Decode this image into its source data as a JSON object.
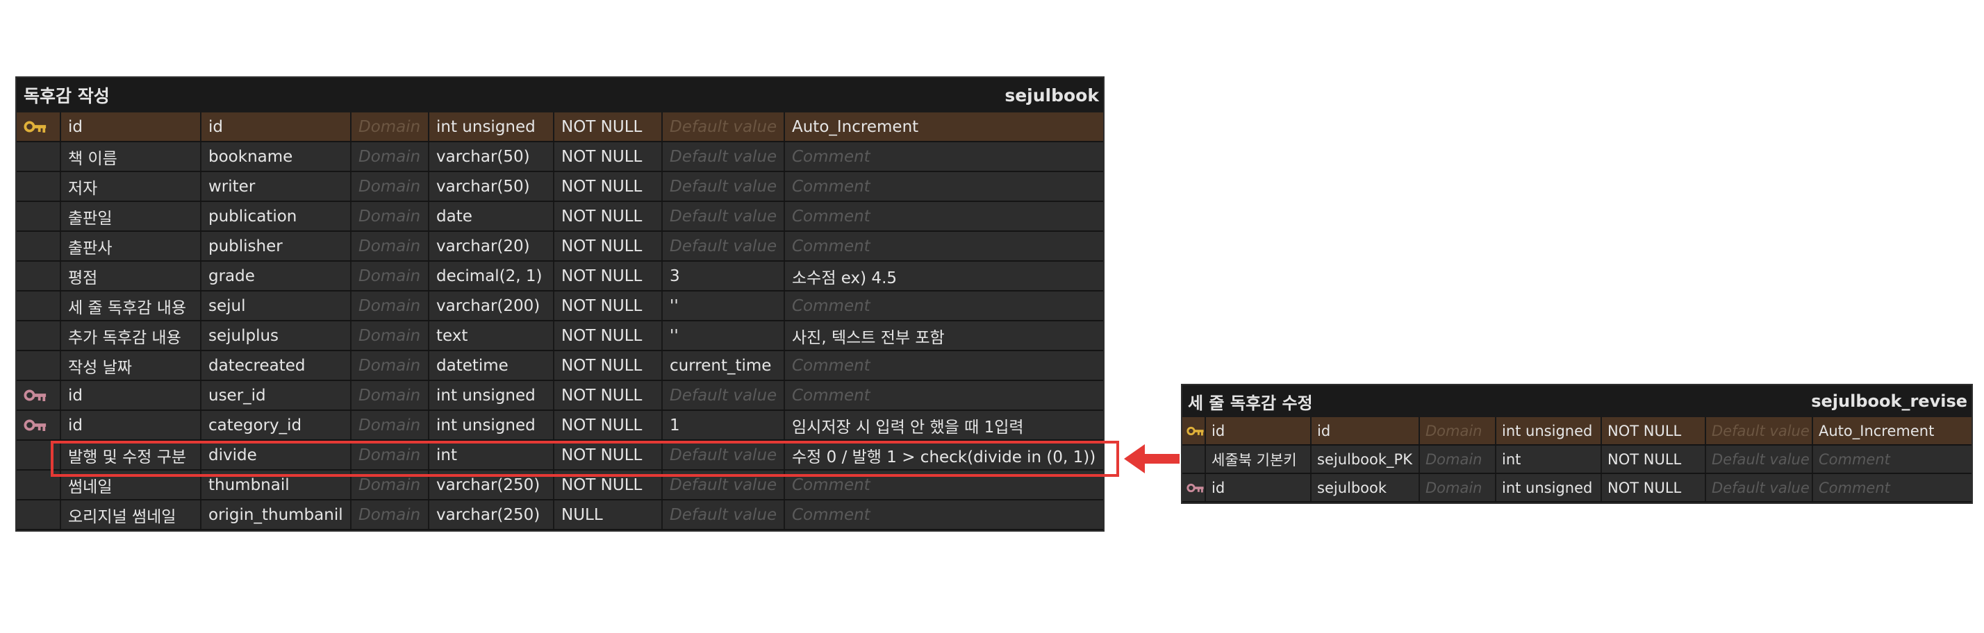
{
  "table1": {
    "title": "독후감 작성",
    "name": "sejulbook",
    "rows": [
      {
        "key": "pk",
        "logical": "id",
        "physical": "id",
        "domain": "Domain",
        "type": "int unsigned",
        "null": "NOT NULL",
        "default": "Default value",
        "comment": "Auto_Increment"
      },
      {
        "key": "",
        "logical": "책 이름",
        "physical": "bookname",
        "domain": "Domain",
        "type": "varchar(50)",
        "null": "NOT NULL",
        "default": "Default value",
        "comment": "Comment"
      },
      {
        "key": "",
        "logical": "저자",
        "physical": "writer",
        "domain": "Domain",
        "type": "varchar(50)",
        "null": "NOT NULL",
        "default": "Default value",
        "comment": "Comment"
      },
      {
        "key": "",
        "logical": "출판일",
        "physical": "publication",
        "domain": "Domain",
        "type": "date",
        "null": "NOT NULL",
        "default": "Default value",
        "comment": "Comment"
      },
      {
        "key": "",
        "logical": "출판사",
        "physical": "publisher",
        "domain": "Domain",
        "type": "varchar(20)",
        "null": "NOT NULL",
        "default": "Default value",
        "comment": "Comment"
      },
      {
        "key": "",
        "logical": "평점",
        "physical": "grade",
        "domain": "Domain",
        "type": "decimal(2, 1)",
        "null": "NOT NULL",
        "default": "3",
        "comment": "소수점 ex) 4.5"
      },
      {
        "key": "",
        "logical": "세 줄 독후감 내용",
        "physical": "sejul",
        "domain": "Domain",
        "type": "varchar(200)",
        "null": "NOT NULL",
        "default": "''",
        "comment": "Comment"
      },
      {
        "key": "",
        "logical": "추가 독후감 내용",
        "physical": "sejulplus",
        "domain": "Domain",
        "type": "text",
        "null": "NOT NULL",
        "default": "''",
        "comment": "사진, 텍스트 전부 포함"
      },
      {
        "key": "",
        "logical": "작성 날짜",
        "physical": "datecreated",
        "domain": "Domain",
        "type": "datetime",
        "null": "NOT NULL",
        "default": "current_time",
        "comment": "Comment"
      },
      {
        "key": "fk",
        "logical": "id",
        "physical": "user_id",
        "domain": "Domain",
        "type": "int unsigned",
        "null": "NOT NULL",
        "default": "Default value",
        "comment": "Comment"
      },
      {
        "key": "fk",
        "logical": "id",
        "physical": "category_id",
        "domain": "Domain",
        "type": "int unsigned",
        "null": "NOT NULL",
        "default": "1",
        "comment": "임시저장 시 입력 안 했을 때 1입력"
      },
      {
        "key": "",
        "logical": "발행 및 수정 구분",
        "physical": "divide",
        "domain": "Domain",
        "type": "int",
        "null": "NOT NULL",
        "default": "Default value",
        "comment": "수정 0 / 발행 1 > check(divide in (0, 1))"
      },
      {
        "key": "",
        "logical": "썸네일",
        "physical": "thumbnail",
        "domain": "Domain",
        "type": "varchar(250)",
        "null": "NOT NULL",
        "default": "Default value",
        "comment": "Comment"
      },
      {
        "key": "",
        "logical": "오리지널 썸네일",
        "physical": "origin_thumbanil",
        "domain": "Domain",
        "type": "varchar(250)",
        "null": "NULL",
        "default": "Default value",
        "comment": "Comment"
      }
    ]
  },
  "table2": {
    "title": "세 줄 독후감 수정",
    "name": "sejulbook_revise",
    "rows": [
      {
        "key": "pk",
        "logical": "id",
        "physical": "id",
        "domain": "Domain",
        "type": "int unsigned",
        "null": "NOT NULL",
        "default": "Default value",
        "comment": "Auto_Increment"
      },
      {
        "key": "",
        "logical": "세줄북 기본키",
        "physical": "sejulbook_PK",
        "domain": "Domain",
        "type": "int",
        "null": "NOT NULL",
        "default": "Default value",
        "comment": "Comment"
      },
      {
        "key": "fk",
        "logical": "id",
        "physical": "sejulbook",
        "domain": "Domain",
        "type": "int unsigned",
        "null": "NOT NULL",
        "default": "Default value",
        "comment": "Comment"
      }
    ]
  },
  "colors": {
    "pk_key": "#e0b13a",
    "fk_key": "#c98a9a",
    "highlight": "#e53935",
    "pk_row": "#4a3423"
  }
}
